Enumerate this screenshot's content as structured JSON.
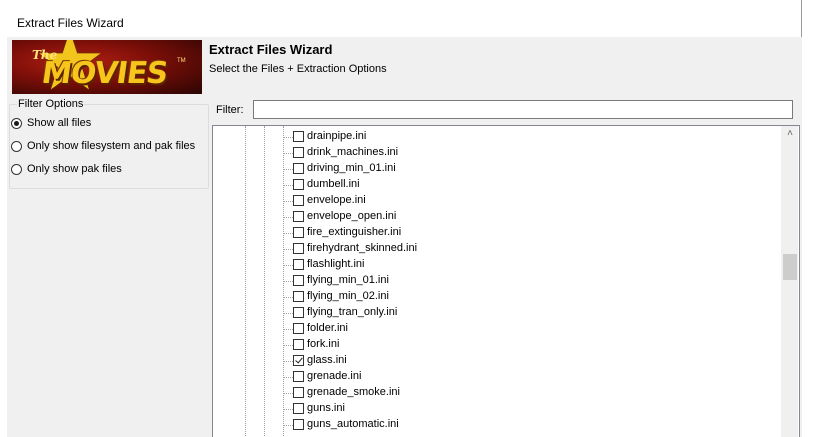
{
  "window": {
    "title": "Extract Files Wizard"
  },
  "header": {
    "logo_the": "The",
    "logo_text": "MOVIES",
    "logo_tm": "TM",
    "title": "Extract Files Wizard",
    "subtitle": "Select the Files + Extraction Options"
  },
  "filter_options": {
    "label": "Filter Options",
    "options": [
      {
        "label": "Show all files",
        "selected": true
      },
      {
        "label": "Only show filesystem and pak files",
        "selected": false
      },
      {
        "label": "Only show pak files",
        "selected": false
      }
    ]
  },
  "filter": {
    "label": "Filter:",
    "value": "",
    "placeholder": ""
  },
  "tree": {
    "items": [
      {
        "label": "drainpipe.ini",
        "checked": false
      },
      {
        "label": "drink_machines.ini",
        "checked": false
      },
      {
        "label": "driving_min_01.ini",
        "checked": false
      },
      {
        "label": "dumbell.ini",
        "checked": false
      },
      {
        "label": "envelope.ini",
        "checked": false
      },
      {
        "label": "envelope_open.ini",
        "checked": false
      },
      {
        "label": "fire_extinguisher.ini",
        "checked": false
      },
      {
        "label": "firehydrant_skinned.ini",
        "checked": false
      },
      {
        "label": "flashlight.ini",
        "checked": false
      },
      {
        "label": "flying_min_01.ini",
        "checked": false
      },
      {
        "label": "flying_min_02.ini",
        "checked": false
      },
      {
        "label": "flying_tran_only.ini",
        "checked": false
      },
      {
        "label": "folder.ini",
        "checked": false
      },
      {
        "label": "fork.ini",
        "checked": false
      },
      {
        "label": "glass.ini",
        "checked": true
      },
      {
        "label": "grenade.ini",
        "checked": false
      },
      {
        "label": "grenade_smoke.ini",
        "checked": false
      },
      {
        "label": "guns.ini",
        "checked": false
      },
      {
        "label": "guns_automatic.ini",
        "checked": false
      }
    ]
  },
  "scrollbar": {
    "up_icon": "chevron-up-icon",
    "position_fraction": 0.42
  }
}
